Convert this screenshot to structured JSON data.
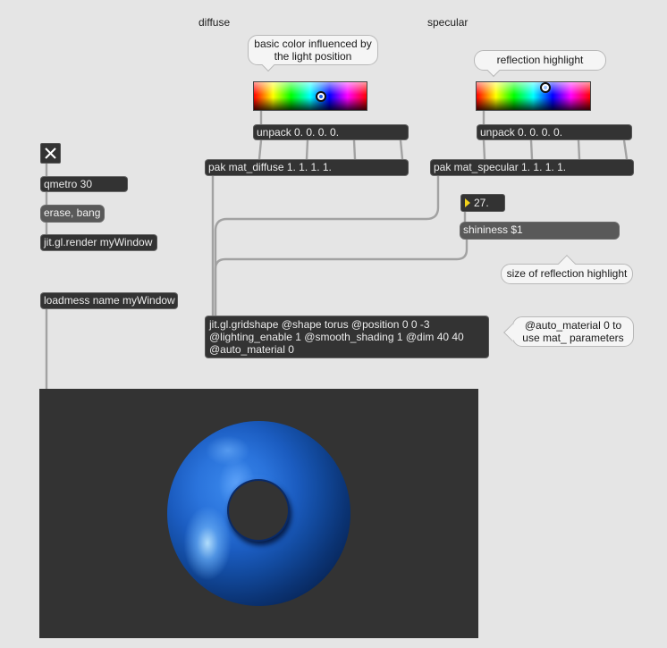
{
  "patcher": {
    "background": "#e5e5e5",
    "cord_color": "#a2a2a2"
  },
  "labels": {
    "diffuse": "diffuse",
    "specular": "specular"
  },
  "comments": {
    "diffuse_color": "basic color influenced by the light position",
    "reflection_highlight": "reflection highlight",
    "shininess_size": "size of reflection highlight",
    "auto_material": "@auto_material 0 to use mat_ parameters"
  },
  "toggle": {
    "checked": true,
    "icon": "x-icon"
  },
  "objects": {
    "qmetro": "qmetro 30",
    "render": "jit.gl.render myWindow",
    "loadmess": "loadmess name myWindow",
    "unpack_diffuse": "unpack 0. 0. 0. 0.",
    "unpack_specular": "unpack 0. 0. 0. 0.",
    "pak_diffuse": "pak mat_diffuse 1. 1. 1. 1.",
    "pak_specular": "pak mat_specular 1. 1. 1. 1.",
    "gridshape": "jit.gl.gridshape @shape torus @position 0 0 -3 @lighting_enable 1 @smooth_shading 1 @dim 40 40 @auto_material 0"
  },
  "messages": {
    "erase_bang": "erase, bang",
    "shininess": "shininess $1"
  },
  "number_box": {
    "value": "27.",
    "icon": "triangle-icon",
    "triangle_color": "#f2d21b"
  },
  "swatches": {
    "diffuse": {
      "hue": 0.594,
      "shade": 0.515,
      "selected_color": "#1c63e0"
    },
    "specular": {
      "hue": 0.605,
      "shade": 0.18,
      "selected_color": "#9cc4ff"
    }
  },
  "pwindow": {
    "background": "#333333",
    "torus_color": "#1f5fc4"
  }
}
